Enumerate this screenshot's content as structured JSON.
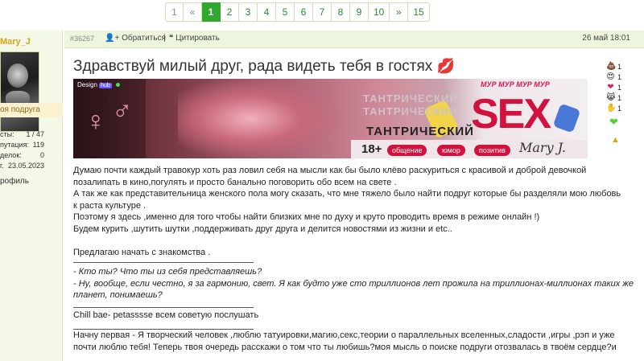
{
  "pagination": {
    "first": "1",
    "prev": "«",
    "pages": [
      "1",
      "2",
      "3",
      "4",
      "5",
      "6",
      "7",
      "8",
      "9",
      "10"
    ],
    "active": "1",
    "next": "»",
    "last": "15"
  },
  "author": {
    "username": "Mary_J",
    "rank": "оя подруга",
    "stats": [
      {
        "label": "сты:",
        "value": "1 / 47"
      },
      {
        "label": "путация:",
        "value": "119"
      },
      {
        "label": "делок:",
        "value": "0"
      },
      {
        "label": "г.",
        "value": "23.05.2023"
      }
    ],
    "profile_link": "рофиль"
  },
  "post": {
    "id": "#36267",
    "reply_action": "Обратиться",
    "separator": "|",
    "quote_action": "Цитировать",
    "date": "26 май 18:01",
    "title": "Здравствуй милый друг, рада видеть тебя в гостях",
    "title_emoji": "💋"
  },
  "banner": {
    "design_label": "Design",
    "hub_label": "hub",
    "meow": "МУР МУР МУР МУР",
    "tantric_ghost": "ТАНТРИЧЕСКИЙ",
    "tantric": "ТАНТРИЧЕСКИЙ",
    "sex": "SEX",
    "age": "18+",
    "tags": [
      "общение",
      "юмор",
      "позитив"
    ],
    "signature": "Mary J."
  },
  "reactions": [
    {
      "icon": "💩",
      "count": "1"
    },
    {
      "icon": "😍",
      "count": "1"
    },
    {
      "icon": "❤",
      "count": "1"
    },
    {
      "icon": "😹",
      "count": "1"
    },
    {
      "icon": "✋",
      "count": "1"
    }
  ],
  "body": {
    "line1": "Думаю почти каждый травокур хоть раз ловил себя на мысли как бы было клёво раскуриться с красивой и доброй девочкой",
    "line2": "позалипать в кино,погулять и просто банально поговорить обо всем на свете .",
    "line3": "А так же как представительница женского пола могу сказать, что мне тяжело было найти подруг которые бы разделяли мою любовь",
    "line4": "к раста культуре .",
    "line5": "Поэтому я здесь ,именно для того чтобы найти близких мне по духу и круто проводить время в режиме онлайн !)",
    "line6": "Будем курить ,шутить шутки ,поддерживать друг друга и делится новостями из жизни и etc..",
    "intro": "Предлагаю начать с знакомства .",
    "q1": "- Кто ты? Что ты из себя представляешь?",
    "q2a": "- Ну, вообще, если честно, я за гармонию, свет. Я как будто уже сто триллионов лет прожила на триллионах-миллионах таких же",
    "q2b": "планет, понимаешь?",
    "chill": "Chill bae- petassssе всем советую послушать",
    "first_a": "Начну первая - Я творческий человек ,люблю татуировки,магию,секс,теории о параллельных вселенных,сладости ,игры ,рэп и уже",
    "first_b": "почти люблю тебя! Теперь твоя очередь расскажи о том что ты любишь?моя мысль о поиске подруги отозвалась в твоём сердце?и"
  }
}
